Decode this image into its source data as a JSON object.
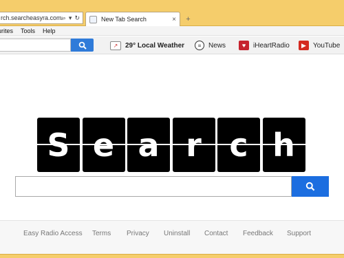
{
  "browser": {
    "address_url": "rch.searcheasyra.com/",
    "tab_title": "New Tab Search",
    "tab_close": "×",
    "new_tab": "+"
  },
  "menu": {
    "items": [
      "urites",
      "Tools",
      "Help"
    ]
  },
  "toolbar": {
    "weather_label": "29° Local Weather",
    "news_label": "News",
    "iheart_label": "iHeartRadio",
    "youtube_label": "YouTube"
  },
  "logo": {
    "letters": [
      "S",
      "e",
      "a",
      "r",
      "c",
      "h"
    ]
  },
  "search": {
    "placeholder": ""
  },
  "footer": {
    "links": [
      "Easy Radio Access",
      "Terms",
      "Privacy",
      "Uninstall",
      "Contact",
      "Feedback",
      "Support"
    ]
  },
  "colors": {
    "browser_frame": "#f5cd6b",
    "search_button": "#1c6ee0",
    "logo_tile": "#000000"
  }
}
